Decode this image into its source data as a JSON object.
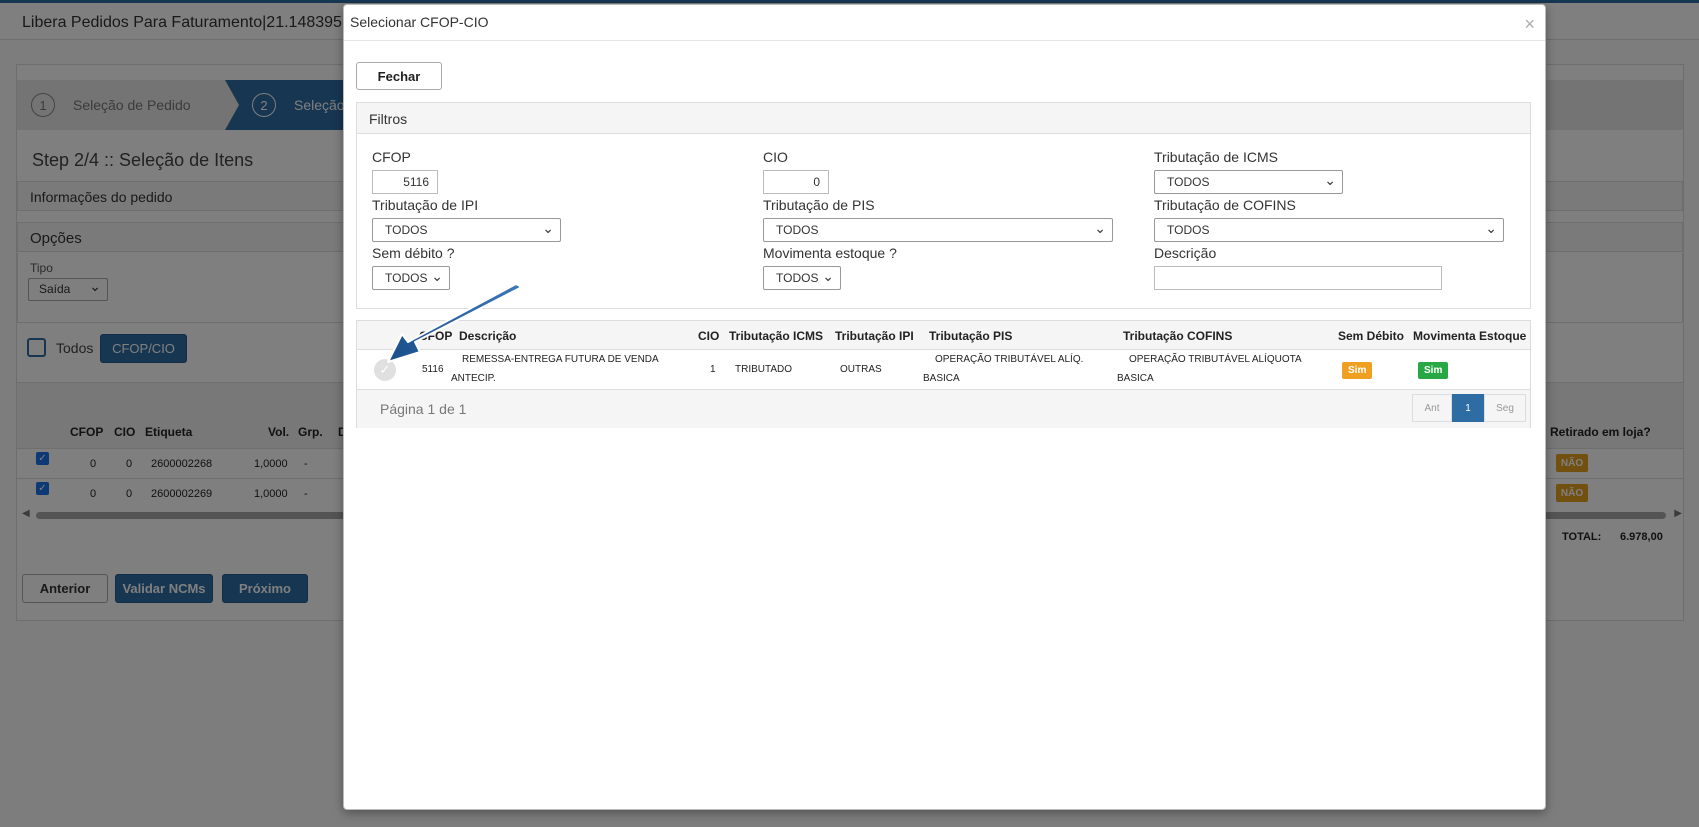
{
  "background": {
    "title": "Libera Pedidos Para Faturamento|21.148395|",
    "wizard": [
      {
        "num": "1",
        "label": "Seleção de Pedido"
      },
      {
        "num": "2",
        "label": "Seleção de"
      }
    ],
    "step_title": "Step 2/4 :: Seleção de Itens",
    "info_section": "Informações do pedido",
    "options_section": "Opções",
    "tipo_label": "Tipo",
    "tipo_value": "Saída",
    "todos_label": "Todos",
    "cfop_cio_button": "CFOP/CIO",
    "table": {
      "headers": [
        "CFOP",
        "CIO",
        "Etiqueta",
        "Vol.",
        "Grp.",
        "D",
        "Retirado em loja?"
      ],
      "rows": [
        {
          "cfop": "0",
          "cio": "0",
          "etiqueta": "2600002268",
          "vol": "1,0000",
          "grp": "-",
          "retirado": "NÃO"
        },
        {
          "cfop": "0",
          "cio": "0",
          "etiqueta": "2600002269",
          "vol": "1,0000",
          "grp": "-",
          "retirado": "NÃO"
        }
      ],
      "total_label": "TOTAL:",
      "total_value": "6.978,00"
    },
    "buttons": {
      "anterior": "Anterior",
      "validar": "Validar NCMs",
      "proximo": "Próximo"
    }
  },
  "modal": {
    "title": "Selecionar CFOP-CIO",
    "close": "×",
    "fechar": "Fechar",
    "filtros": {
      "heading": "Filtros",
      "cfop_label": "CFOP",
      "cfop_value": "5116",
      "cio_label": "CIO",
      "cio_value": "0",
      "icms_label": "Tributação de ICMS",
      "icms_value": "TODOS",
      "ipi_label": "Tributação de IPI",
      "ipi_value": "TODOS",
      "pis_label": "Tributação de PIS",
      "pis_value": "TODOS",
      "cofins_label": "Tributação de COFINS",
      "cofins_value": "TODOS",
      "sem_debito_label": "Sem débito ?",
      "sem_debito_value": "TODOS",
      "movimenta_label": "Movimenta estoque ?",
      "movimenta_value": "TODOS",
      "descricao_label": "Descrição",
      "descricao_value": ""
    },
    "results": {
      "headers": {
        "cfop": "CFOP",
        "descricao": "Descrição",
        "cio": "CIO",
        "icms": "Tributação ICMS",
        "ipi": "Tributação IPI",
        "pis": "Tributação PIS",
        "cofins": "Tributação COFINS",
        "sem_debito": "Sem Débito",
        "movimenta": "Movimenta Estoque"
      },
      "row": {
        "cfop": "5116",
        "descricao_l1": "REMESSA-ENTREGA FUTURA DE VENDA",
        "descricao_l2": "ANTECIP.",
        "cio": "1",
        "icms": "TRIBUTADO",
        "ipi": "OUTRAS",
        "pis_l1": "OPERAÇÃO TRIBUTÁVEL ALÍQ.",
        "pis_l2": "BASICA",
        "cofins_l1": "OPERAÇÃO TRIBUTÁVEL ALÍQUOTA",
        "cofins_l2": "BASICA",
        "sem_debito": "Sim",
        "movimenta": "Sim"
      },
      "page_info": "Página 1 de 1",
      "pager": {
        "prev": "Ant",
        "current": "1",
        "next": "Seg"
      }
    }
  }
}
